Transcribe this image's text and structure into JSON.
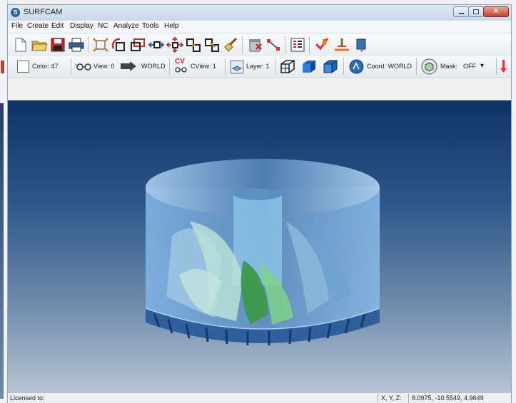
{
  "window": {
    "app_icon_glyph": "S",
    "title": "SURFCAM",
    "close_glyph": "✕"
  },
  "menubar": {
    "items": [
      "File",
      "Create",
      "Edit",
      "Display",
      "NC",
      "Analyze",
      "Tools",
      "Help"
    ]
  },
  "toolbar_icons": [
    "new-file-icon",
    "open-folder-icon",
    "save-icon",
    "print-icon",
    "zoom-extents-icon",
    "rotate-view-icon",
    "zoom-window-icon",
    "pan-icon",
    "move-icon",
    "duplicate-icon",
    "duplicate-alt-icon",
    "broom-icon",
    "delete-icon",
    "snap-icon",
    "layer-table-icon",
    "tool-red-icon",
    "toolpath-icon",
    "operations-icon"
  ],
  "toolbar2": {
    "color_label": "Color: 47",
    "view_label": "View: 0",
    "world_label": ": WORLD",
    "cv_glyph": "CV",
    "cview_label": "CView: 1",
    "layer_label": "Layer: 1",
    "coord_label": "Coord: WORLD",
    "mask_label": "Mask:",
    "mask_value": "OFF",
    "dropdown_glyph": "▾"
  },
  "status": {
    "licensed": "Licensed to:",
    "coord_label": "X, Y, Z:",
    "coord_value": "8.0975, -10.5549, 4.9649"
  },
  "colors": {
    "viewport_top": "#0f3266",
    "viewport_bottom": "#b6c4d3",
    "part_blue": "#6c9fd0",
    "blade_green": "#3a9a4a"
  }
}
